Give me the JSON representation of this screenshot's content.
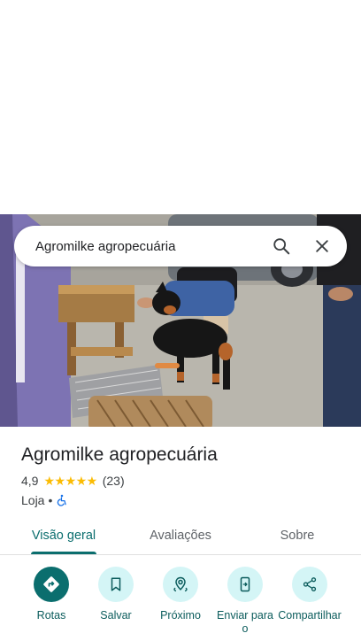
{
  "search": {
    "query": "Agromilke agropecuária",
    "search_icon": "search-icon",
    "close_icon": "close-icon"
  },
  "place": {
    "name": "Agromilke agropecuária",
    "rating": "4,9",
    "stars": "★★★★★",
    "review_count": "(23)",
    "category": "Loja",
    "separator": "•",
    "accessibility_icon": "wheelchair-icon"
  },
  "tabs": [
    {
      "label": "Visão geral",
      "active": true
    },
    {
      "label": "Avaliações",
      "active": false
    },
    {
      "label": "Sobre",
      "active": false
    }
  ],
  "actions": [
    {
      "label": "Rotas",
      "icon": "directions-icon"
    },
    {
      "label": "Salvar",
      "icon": "bookmark-icon"
    },
    {
      "label": "Próximo",
      "icon": "nearby-icon"
    },
    {
      "label": "Enviar para o",
      "icon": "send-to-phone-icon"
    },
    {
      "label": "Compartilhar",
      "icon": "share-icon"
    }
  ],
  "colors": {
    "accent": "#0b6e6e",
    "action_bg": "#d4f5f6",
    "star": "#fbbc04"
  }
}
